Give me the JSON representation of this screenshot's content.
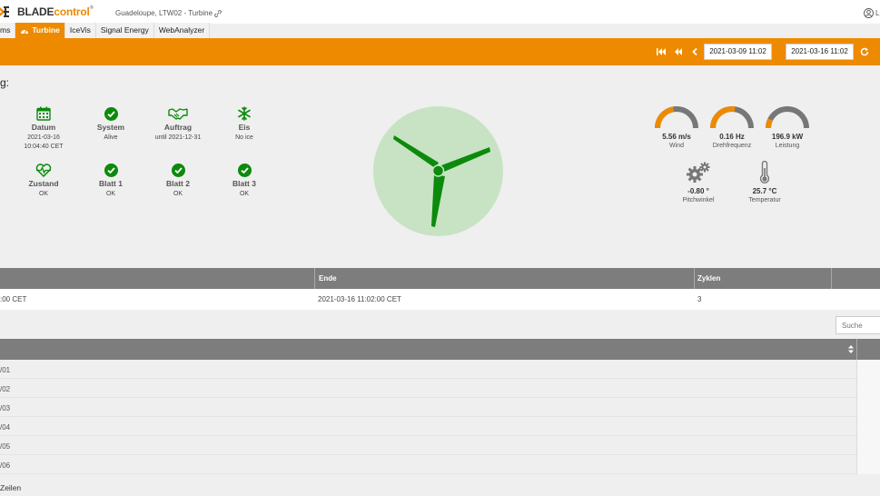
{
  "header": {
    "logo_blade": "BLADE",
    "logo_control": "control",
    "logo_reg": "®",
    "site": "Guadeloupe, LTW02  - Turbine",
    "user": "L"
  },
  "nav": {
    "tabs": [
      {
        "label": "ms",
        "active": false
      },
      {
        "label": "Turbine",
        "active": true
      },
      {
        "label": "IceVis",
        "active": false
      },
      {
        "label": "Signal Energy",
        "active": false
      },
      {
        "label": "WebAnalyzer",
        "active": false
      }
    ]
  },
  "toolbar": {
    "date_from": "2021-03-09 11:02",
    "date_to": "2021-03-16 11:02"
  },
  "heading": "g:",
  "status": {
    "datum": {
      "label": "Datum",
      "value": "2021-03-16\n10:04:40 CET"
    },
    "system": {
      "label": "System",
      "value": "Alive"
    },
    "auftrag": {
      "label": "Auftrag",
      "value": "until 2021-12-31"
    },
    "eis": {
      "label": "Eis",
      "value": "No ice"
    },
    "zustand": {
      "label": "Zustand",
      "value": "OK"
    },
    "blatt1": {
      "label": "Blatt 1",
      "value": "OK"
    },
    "blatt2": {
      "label": "Blatt 2",
      "value": "OK"
    },
    "blatt3": {
      "label": "Blatt 3",
      "value": "OK"
    }
  },
  "gauges": {
    "wind": {
      "value": "5.56 m/s",
      "name": "Wind",
      "fill": 0.45
    },
    "drehfrequenz": {
      "value": "0.16 Hz",
      "name": "Drehfrequenz",
      "fill": 0.55
    },
    "leistung": {
      "value": "196.9 kW",
      "name": "Leistung",
      "fill": 0.15
    },
    "pitchwinkel": {
      "value": "-0.80 °",
      "name": "Pitchwinkel"
    },
    "temperatur": {
      "value": "25.7 °C",
      "name": "Temperatur"
    }
  },
  "table1": {
    "headers": {
      "ende": "Ende",
      "zyklen": "Zyklen"
    },
    "row": {
      "start": ":00 CET",
      "ende": "2021-03-16 11:02:00 CET",
      "zyklen": "3"
    }
  },
  "search": {
    "placeholder": "Suche"
  },
  "table2": {
    "rows": [
      "/01",
      "/02",
      "/03",
      "/04",
      "/05",
      "/06"
    ]
  },
  "footer": "Zeilen",
  "colors": {
    "accent": "#ee8a00",
    "ok_green": "#0c8a0c",
    "turbine_bg": "#c7e3c4",
    "table_header": "#7d7d7d"
  }
}
